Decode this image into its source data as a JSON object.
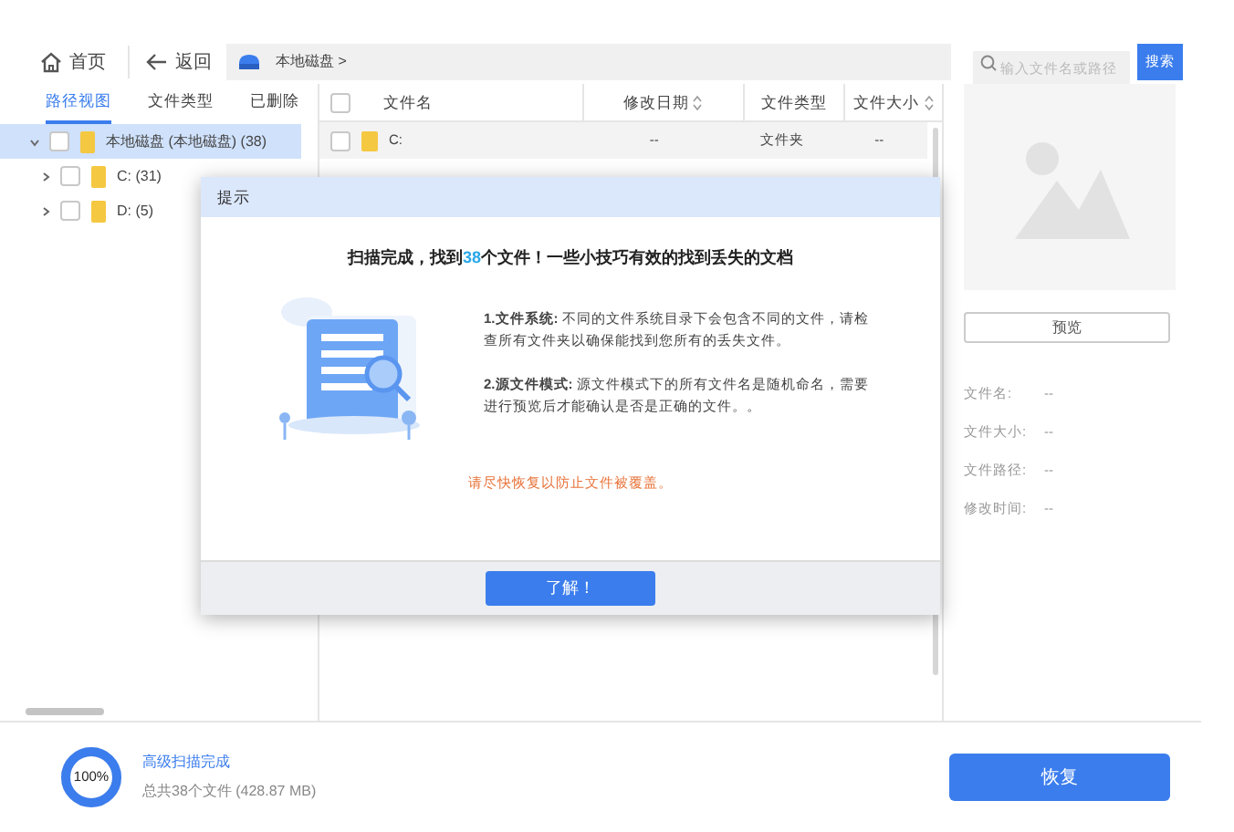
{
  "toolbar": {
    "home": "首页",
    "back": "返回",
    "path": "本地磁盘 >",
    "search": {
      "placeholder": "输入文件名或路径",
      "button": "搜索"
    }
  },
  "view_tabs": [
    {
      "label": "路径视图",
      "selected": true
    },
    {
      "label": "文件类型",
      "selected": false
    },
    {
      "label": "已删除",
      "selected": false
    }
  ],
  "tree": [
    {
      "label": "本地磁盘 (本地磁盘) (38)",
      "expanded": true,
      "selected": true,
      "checked": false,
      "children": [
        {
          "label": "C: (31)",
          "expanded": false,
          "selected": false,
          "checked": false
        },
        {
          "label": "D: (5)",
          "expanded": false,
          "selected": false,
          "checked": false
        }
      ]
    }
  ],
  "table": {
    "select_all_checked": false,
    "columns": [
      {
        "label": "文件名",
        "sortable": false
      },
      {
        "label": "修改日期",
        "sortable": true
      },
      {
        "label": "文件类型",
        "sortable": false
      },
      {
        "label": "文件大小",
        "sortable": true
      }
    ],
    "rows": [
      {
        "name": "C:",
        "date": "--",
        "type": "文件夹",
        "size": "--",
        "selected": true,
        "checked": false
      }
    ]
  },
  "preview": {
    "button": "预览",
    "fields": [
      {
        "label": "文件名:",
        "value": "--"
      },
      {
        "label": "文件大小:",
        "value": "--"
      },
      {
        "label": "文件路径:",
        "value": "--"
      },
      {
        "label": "修改时间:",
        "value": "--"
      }
    ]
  },
  "status": {
    "progress": "100%",
    "level": 1,
    "title": "高级扫描完成",
    "summary": "总共38个文件 (428.87 MB)",
    "restore": "恢复"
  },
  "dialog": {
    "title": "提示",
    "heading": [
      {
        "text": "扫描完成，找到",
        "highlight": false
      },
      {
        "text": "38",
        "highlight": true
      },
      {
        "text": "个文件！一些小技巧有效的找到丢失的文档",
        "highlight": false
      }
    ],
    "tips": [
      "**1.文件系统:** 不同的文件系统目录下会包含不同的文件，请检查所有文件夹以确保能找到您所有的丢失文件。",
      "**2.源文件模式:** 源文件模式下的所有文件名是随机命名，需要进行预览后才能确认是否是正确的文件。。"
    ],
    "warning": "请尽快恢复以防止文件被覆盖。",
    "ok": "了解！"
  }
}
